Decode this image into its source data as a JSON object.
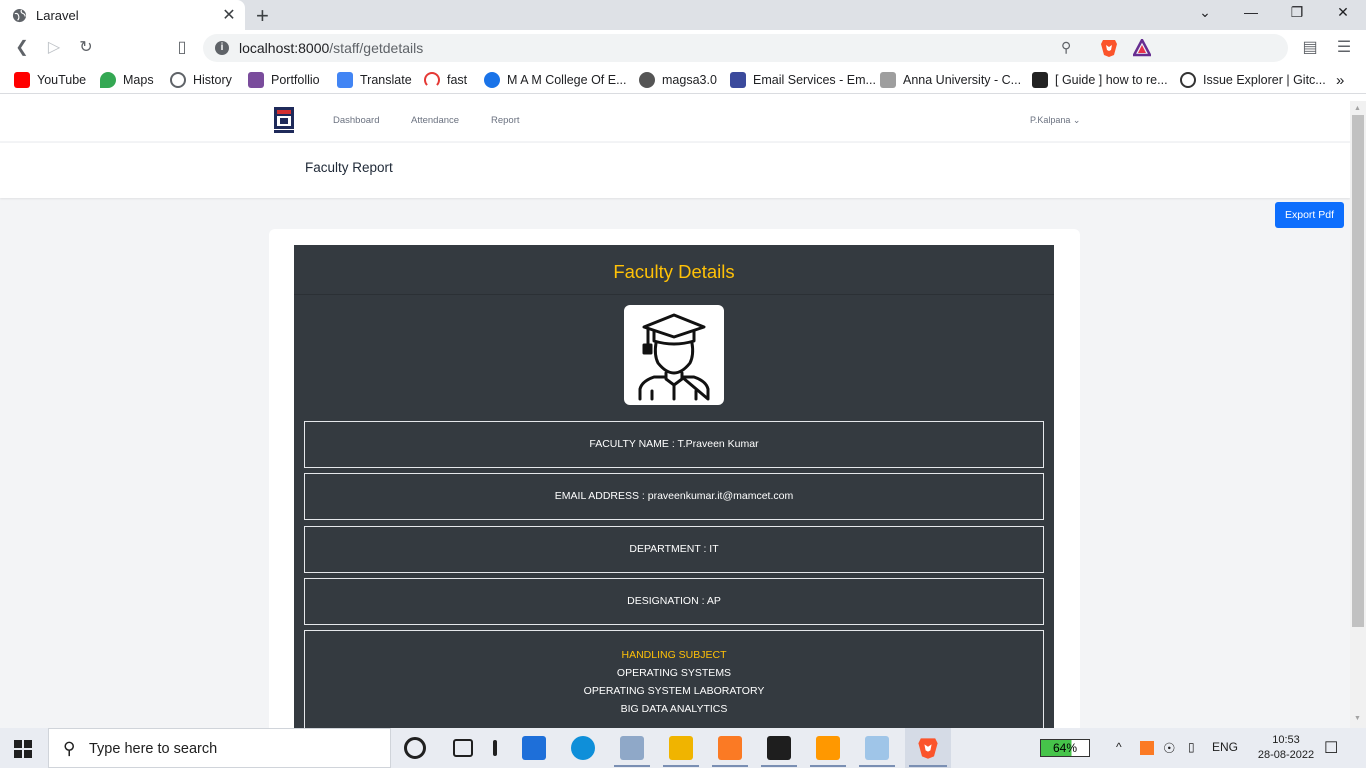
{
  "browser": {
    "tab_title": "Laravel",
    "tab_close": "✕",
    "new_tab": "+",
    "url_host": "localhost:8000",
    "url_path": "/staff/getdetails",
    "bookmarks": [
      {
        "label": "YouTube",
        "color": "#ff0000"
      },
      {
        "label": "Maps",
        "color": "#34a853"
      },
      {
        "label": "History",
        "color": "#5f6368"
      },
      {
        "label": "Portfollio",
        "color": "#7a4c9c"
      },
      {
        "label": "Translate",
        "color": "#4285f4"
      },
      {
        "label": "fast",
        "color": "#e53935"
      },
      {
        "label": "M A M College Of E...",
        "color": "#1a73e8"
      },
      {
        "label": "magsa3.0",
        "color": "#555555"
      },
      {
        "label": "Email Services - Em...",
        "color": "#3b4a9c"
      },
      {
        "label": "Anna University - C...",
        "color": "#777777"
      },
      {
        "label": "[ Guide ] how to re...",
        "color": "#222222"
      },
      {
        "label": "Issue Explorer | Gitc...",
        "color": "#333333"
      }
    ],
    "more_bookmarks": "»"
  },
  "app": {
    "nav": {
      "dashboard": "Dashboard",
      "attendance": "Attendance",
      "report": "Report",
      "user": "P.Kalpana ⌄"
    },
    "header_title": "Faculty Report",
    "export_button": "Export Pdf",
    "panel_title": "Faculty Details",
    "fields": {
      "name": "FACULTY NAME : T.Praveen Kumar",
      "email": "EMAIL ADDRESS : praveenkumar.it@mamcet.com",
      "department": "DEPARTMENT : IT",
      "designation": "DESIGNATION : AP"
    },
    "subjects": {
      "heading": "HANDLING SUBJECT",
      "items": [
        "OPERATING SYSTEMS",
        "OPERATING SYSTEM LABORATORY",
        "BIG DATA ANALYTICS"
      ]
    },
    "colors": {
      "panel_bg": "#343a40",
      "accent": "#ffc107",
      "button": "#0d6efd"
    }
  },
  "taskbar": {
    "search_placeholder": "Type here to search",
    "battery": "64%",
    "language": "ENG",
    "time": "10:53",
    "date": "28-08-2022"
  }
}
